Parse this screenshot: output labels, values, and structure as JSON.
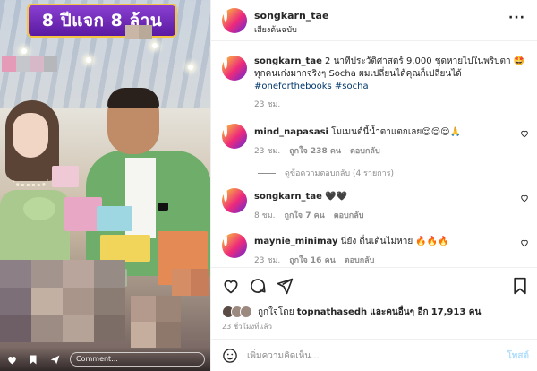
{
  "photo": {
    "banner_text": "8 ปีแจก 8 ล้าน",
    "comment_placeholder": "Comment..."
  },
  "post": {
    "username": "songkarn_tae",
    "audio": "เสียงต้นฉบับ",
    "caption": {
      "username": "songkarn_tae",
      "text": "2 นาทีประวัติศาสตร์ 9,000 ชุดหายไปในพริบตา 🤩 ทุกคนเก่งมากจริงๆ Socha ผมเปลี่ยนได้คุณก็เปลี่ยนได้",
      "hashtags": "#oneforthebooks #socha",
      "time": "23 ชม."
    },
    "comments": [
      {
        "username": "mind_napasasi",
        "text": "โมเมนต์นี้น้ำตาแตกเลย😌😌😌🙏",
        "time": "23 ชม.",
        "likes": "ถูกใจ 238 คน",
        "reply": "ตอบกลับ"
      },
      {
        "username": "songkarn_tae",
        "text": "🖤🖤",
        "time": "8 ชม.",
        "likes": "ถูกใจ 7 คน",
        "reply": "ตอบกลับ"
      },
      {
        "username": "maynie_minimay",
        "text": "นี่ยัง ตื่นเต้นไม่หาย 🔥🔥🔥",
        "time": "23 ชม.",
        "likes": "ถูกใจ 16 คน",
        "reply": "ตอบกลับ"
      }
    ],
    "view_replies": "ดูข้อความตอบกลับ (4 รายการ)",
    "liked_by": {
      "prefix": "ถูกใจโดย",
      "user": "topnathasedh",
      "middle": "และคนอื่นๆ อีก",
      "count": "17,913 คน"
    },
    "posted": "23 ชั่วโมงที่แล้ว",
    "add_comment_placeholder": "เพิ่มความคิดเห็น...",
    "post_label": "โพสต์"
  },
  "colors": {
    "link": "#00376b",
    "muted": "#8e8e8e",
    "post_disabled": "#b2dffc"
  }
}
